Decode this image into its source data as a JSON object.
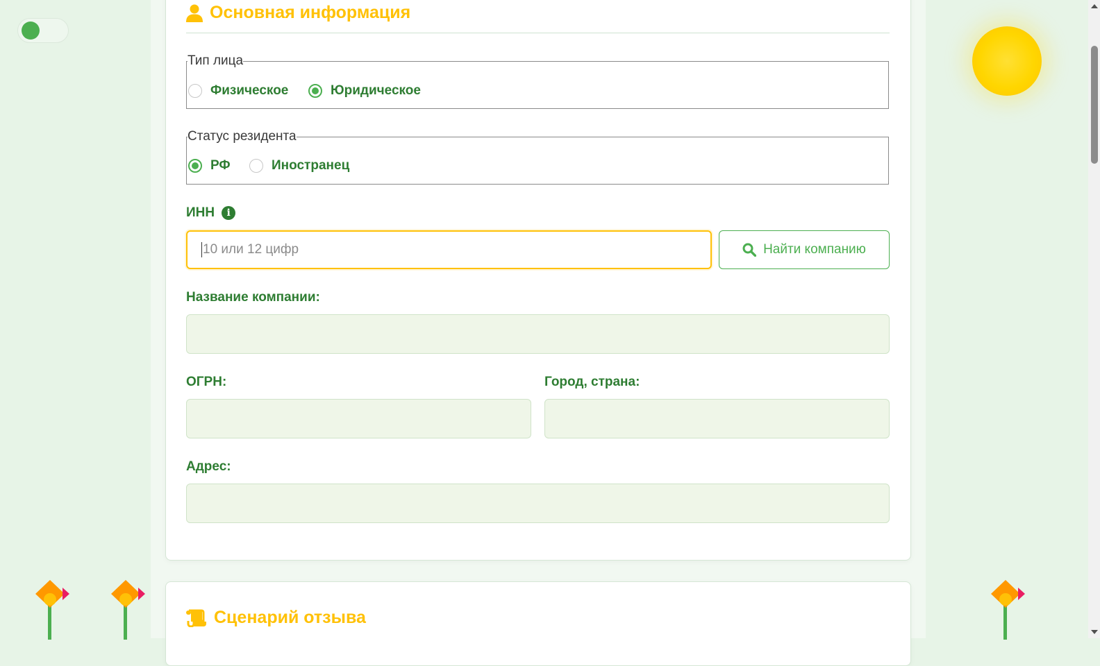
{
  "colors": {
    "accent": "#ffc107",
    "primary_green": "#2e7d32",
    "button_green": "#4caf50",
    "readonly_field_bg": "#eff6e8"
  },
  "theme_toggle": {
    "icon": "toggle-switch"
  },
  "main_section": {
    "title": "Основная информация",
    "icon": "user-icon",
    "person_type": {
      "legend": "Тип лица",
      "options": [
        {
          "label": "Физическое",
          "selected": false
        },
        {
          "label": "Юридическое",
          "selected": true
        }
      ]
    },
    "resident_status": {
      "legend": "Статус резидента",
      "options": [
        {
          "label": "РФ",
          "selected": true
        },
        {
          "label": "Иностранец",
          "selected": false
        }
      ]
    },
    "inn": {
      "label": "ИНН",
      "info_icon": "info-icon",
      "placeholder": "10 или 12 цифр",
      "value": ""
    },
    "find_button": {
      "label": "Найти компанию",
      "icon": "search-icon"
    },
    "company_name": {
      "label": "Название компании:",
      "value": ""
    },
    "ogrn": {
      "label": "ОГРН:",
      "value": ""
    },
    "city_country": {
      "label": "Город, страна:",
      "value": ""
    },
    "address": {
      "label": "Адрес:",
      "value": ""
    }
  },
  "scenario_section": {
    "title": "Сценарий отзыва",
    "icon": "scroll-icon"
  },
  "decor": {
    "sun": "sun-decoration",
    "flowers": [
      "flower-decoration",
      "flower-decoration",
      "flower-decoration"
    ]
  }
}
